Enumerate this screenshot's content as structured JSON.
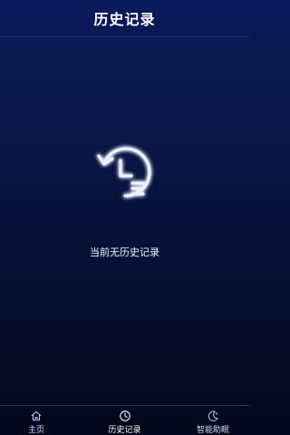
{
  "header": {
    "title": "历史记录"
  },
  "empty_state": {
    "icon": "history-clock-icon",
    "message": "当前无历史记录"
  },
  "tabbar": {
    "items": [
      {
        "label": "主页",
        "icon": "home-icon",
        "active": false
      },
      {
        "label": "历史记录",
        "icon": "clock-icon",
        "active": true
      },
      {
        "label": "智能助眠",
        "icon": "moon-icon",
        "active": false
      }
    ]
  },
  "colors": {
    "bg_top": "#0b1a5c",
    "bg_bottom": "#02081a",
    "accent_glow": "#6f86ff",
    "text": "#ffffff"
  }
}
